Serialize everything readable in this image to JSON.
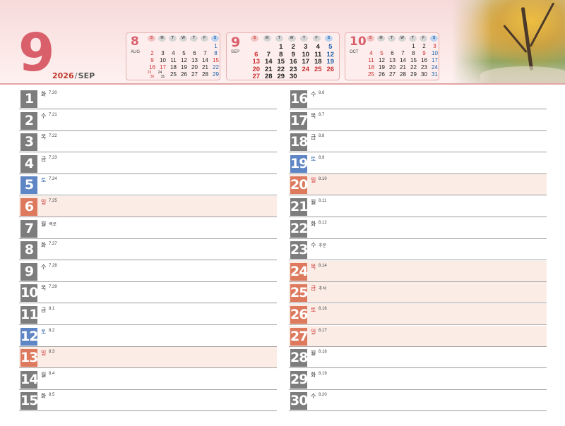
{
  "header": {
    "big_month": "9",
    "year": "2026",
    "slash": "/",
    "month_name": "SEP",
    "weekday_heads": [
      "S",
      "M",
      "T",
      "W",
      "T",
      "F",
      "S"
    ]
  },
  "mini_calendars": [
    {
      "num": "8",
      "name": "AUG",
      "first_weekday": 6,
      "days": 31,
      "current": false,
      "merged": {
        "cell": 35,
        "top": "23",
        "bottom": "30",
        "top_day": 23,
        "bottom_day": 30
      },
      "merged2": {
        "cell": 36,
        "top": "24",
        "bottom": "31",
        "top_day": 24,
        "bottom_day": 31
      },
      "holidays": [
        15,
        17
      ]
    },
    {
      "num": "9",
      "name": "SEP",
      "first_weekday": 2,
      "days": 30,
      "current": true,
      "holidays": [
        24,
        25,
        26
      ]
    },
    {
      "num": "10",
      "name": "OCT",
      "first_weekday": 4,
      "days": 31,
      "current": false,
      "holidays": [
        3,
        5,
        9
      ]
    }
  ],
  "days": [
    {
      "day": "1",
      "weekday": "화",
      "lunar": "7.20",
      "type": "normal"
    },
    {
      "day": "2",
      "weekday": "수",
      "lunar": "7.21",
      "type": "normal"
    },
    {
      "day": "3",
      "weekday": "목",
      "lunar": "7.22",
      "type": "normal"
    },
    {
      "day": "4",
      "weekday": "금",
      "lunar": "7.23",
      "type": "normal"
    },
    {
      "day": "5",
      "weekday": "토",
      "lunar": "7.24",
      "type": "saturday"
    },
    {
      "day": "6",
      "weekday": "일",
      "lunar": "7.25",
      "type": "sunday"
    },
    {
      "day": "7",
      "weekday": "월",
      "lunar": "백로",
      "type": "normal"
    },
    {
      "day": "8",
      "weekday": "화",
      "lunar": "7.27",
      "type": "normal"
    },
    {
      "day": "9",
      "weekday": "수",
      "lunar": "7.28",
      "type": "normal"
    },
    {
      "day": "10",
      "weekday": "목",
      "lunar": "7.29",
      "type": "normal"
    },
    {
      "day": "11",
      "weekday": "금",
      "lunar": "8.1",
      "type": "normal"
    },
    {
      "day": "12",
      "weekday": "토",
      "lunar": "8.2",
      "type": "saturday"
    },
    {
      "day": "13",
      "weekday": "일",
      "lunar": "8.3",
      "type": "sunday"
    },
    {
      "day": "14",
      "weekday": "월",
      "lunar": "8.4",
      "type": "normal"
    },
    {
      "day": "15",
      "weekday": "화",
      "lunar": "8.5",
      "type": "normal"
    },
    {
      "day": "16",
      "weekday": "수",
      "lunar": "8.6",
      "type": "normal"
    },
    {
      "day": "17",
      "weekday": "목",
      "lunar": "8.7",
      "type": "normal"
    },
    {
      "day": "18",
      "weekday": "금",
      "lunar": "8.8",
      "type": "normal"
    },
    {
      "day": "19",
      "weekday": "토",
      "lunar": "8.9",
      "type": "saturday"
    },
    {
      "day": "20",
      "weekday": "일",
      "lunar": "8.10",
      "type": "sunday"
    },
    {
      "day": "21",
      "weekday": "월",
      "lunar": "8.11",
      "type": "normal"
    },
    {
      "day": "22",
      "weekday": "화",
      "lunar": "8.12",
      "type": "normal"
    },
    {
      "day": "23",
      "weekday": "수",
      "lunar": "추분",
      "type": "normal"
    },
    {
      "day": "24",
      "weekday": "목",
      "lunar": "8.14",
      "type": "holiday"
    },
    {
      "day": "25",
      "weekday": "금",
      "lunar": "추석",
      "type": "holiday"
    },
    {
      "day": "26",
      "weekday": "토",
      "lunar": "8.16",
      "type": "holiday"
    },
    {
      "day": "27",
      "weekday": "일",
      "lunar": "8.17",
      "type": "sunday"
    },
    {
      "day": "28",
      "weekday": "월",
      "lunar": "8.18",
      "type": "normal"
    },
    {
      "day": "29",
      "weekday": "화",
      "lunar": "8.19",
      "type": "normal"
    },
    {
      "day": "30",
      "weekday": "수",
      "lunar": "8.20",
      "type": "normal"
    }
  ]
}
